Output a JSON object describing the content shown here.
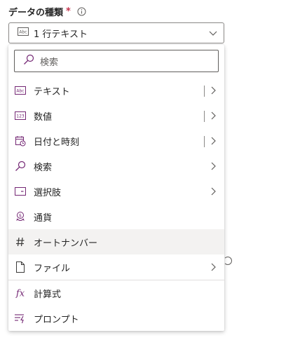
{
  "field": {
    "label": "データの種類",
    "required_mark": "*"
  },
  "select": {
    "value": "1 行テキスト",
    "icon": "text-abc-icon"
  },
  "search": {
    "placeholder": "検索"
  },
  "items": [
    {
      "label": "テキスト",
      "icon": "text-abc-icon",
      "submenu": true,
      "separator": true
    },
    {
      "label": "数値",
      "icon": "number-123-icon",
      "submenu": true,
      "separator": true
    },
    {
      "label": "日付と時刻",
      "icon": "calendar-clock-icon",
      "submenu": true,
      "separator": true
    },
    {
      "label": "検索",
      "icon": "search-icon",
      "submenu": true,
      "separator": false
    },
    {
      "label": "選択肢",
      "icon": "choice-icon",
      "submenu": true,
      "separator": false
    },
    {
      "label": "通貨",
      "icon": "currency-icon",
      "submenu": false,
      "separator": false
    },
    {
      "label": "オートナンバー",
      "icon": "hash-icon",
      "submenu": false,
      "separator": false,
      "highlighted": true
    },
    {
      "label": "ファイル",
      "icon": "file-icon",
      "submenu": true,
      "separator": false
    },
    {
      "label": "計算式",
      "icon": "formula-fx-icon",
      "submenu": false,
      "separator": false
    },
    {
      "label": "プロンプト",
      "icon": "prompt-icon",
      "submenu": false,
      "separator": false
    }
  ],
  "colors": {
    "accent": "#742774",
    "highlight_bg": "#f3f2f1",
    "text": "#242424",
    "required": "#c4314b"
  }
}
